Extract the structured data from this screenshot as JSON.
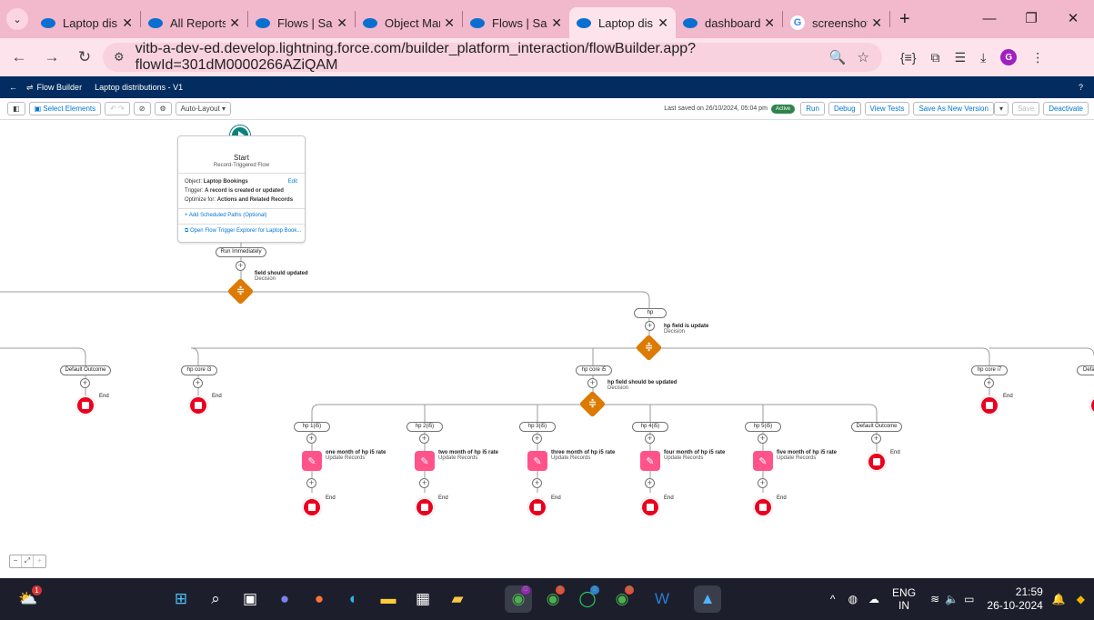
{
  "browser": {
    "tabs": [
      {
        "label": "Laptop dis",
        "favicon": "salesforce-cloud"
      },
      {
        "label": "All Reports",
        "favicon": "salesforce-cloud"
      },
      {
        "label": "Flows | Sale",
        "favicon": "salesforce-cloud"
      },
      {
        "label": "Object Mar",
        "favicon": "salesforce-cloud"
      },
      {
        "label": "Flows | Sale",
        "favicon": "salesforce-cloud"
      },
      {
        "label": "Laptop dis",
        "favicon": "salesforce-cloud",
        "active": true
      },
      {
        "label": "dashboard",
        "favicon": "salesforce-cloud"
      },
      {
        "label": "screenshot",
        "favicon": "google-g"
      }
    ],
    "url": "vitb-a-dev-ed.develop.lightning.force.com/builder_platform_interaction/flowBuilder.app?flowId=301dM0000266AZiQAM",
    "profile_initial": "G"
  },
  "app": {
    "name": "Flow Builder",
    "flow_title": "Laptop distributions - V1",
    "help": "?"
  },
  "toolbar": {
    "select_elements": "Select Elements",
    "auto_layout": "Auto-Layout",
    "last_saved": "Last saved on 26/10/2024, 05:04 pm",
    "status": "Active",
    "run": "Run",
    "debug": "Debug",
    "view_tests": "View Tests",
    "save_as_new": "Save As New Version",
    "save": "Save",
    "deactivate": "Deactivate"
  },
  "start": {
    "title": "Start",
    "subtitle": "Record-Triggered Flow",
    "object_label": "Object:",
    "object_value": "Laptop Bookings",
    "edit": "Edit",
    "trigger_label": "Trigger:",
    "trigger_value": "A record is created or updated",
    "optimize_label": "Optimize for:",
    "optimize_value": "Actions and Related Records",
    "add_path": "+ Add Scheduled Paths (Optional)",
    "open_explorer": "Open Flow Trigger Explorer for Laptop Book..."
  },
  "flow": {
    "run_immediately": "Run Immediately",
    "decision1": {
      "name": "field should updated",
      "type": "Decision"
    },
    "branch_hp": "hp",
    "decision2": {
      "name": "hp field is update",
      "type": "Decision"
    },
    "default_outcome": "Default Outcome",
    "hp_core_i3": "hp core i3",
    "hp_core_i5": "hp core i5",
    "hp_core_i7": "hp core i7",
    "default_cut": "Defau",
    "decision3": {
      "name": "hp field should be updated",
      "type": "Decision"
    },
    "end": "End",
    "update_type": "Update Records",
    "sub_branches": [
      {
        "outcome": "hp 1(i5)",
        "action": "one month of hp i5 rate"
      },
      {
        "outcome": "hp 2(i5)",
        "action": "two month of hp i5 rate"
      },
      {
        "outcome": "hp 3(i5)",
        "action": "three month of hp i5 rate"
      },
      {
        "outcome": "hp 4(i5)",
        "action": "four month of hp i5 rate"
      },
      {
        "outcome": "hp 5(i5)",
        "action": "five month of hp i5 rate"
      }
    ]
  },
  "taskbar": {
    "weather_badge": "1",
    "app_badges": [
      "G",
      "5",
      "2",
      "R"
    ],
    "language": "ENG",
    "region": "IN",
    "time": "21:59",
    "date": "26-10-2024"
  },
  "colors": {
    "sf_navy": "#032d60",
    "start_teal": "#0b827c",
    "decision_orange": "#dd7a01",
    "end_red": "#ea001e",
    "update_pink": "#ff538a",
    "active_green": "#2e844a",
    "chrome_pink": "#f2b8cc"
  }
}
